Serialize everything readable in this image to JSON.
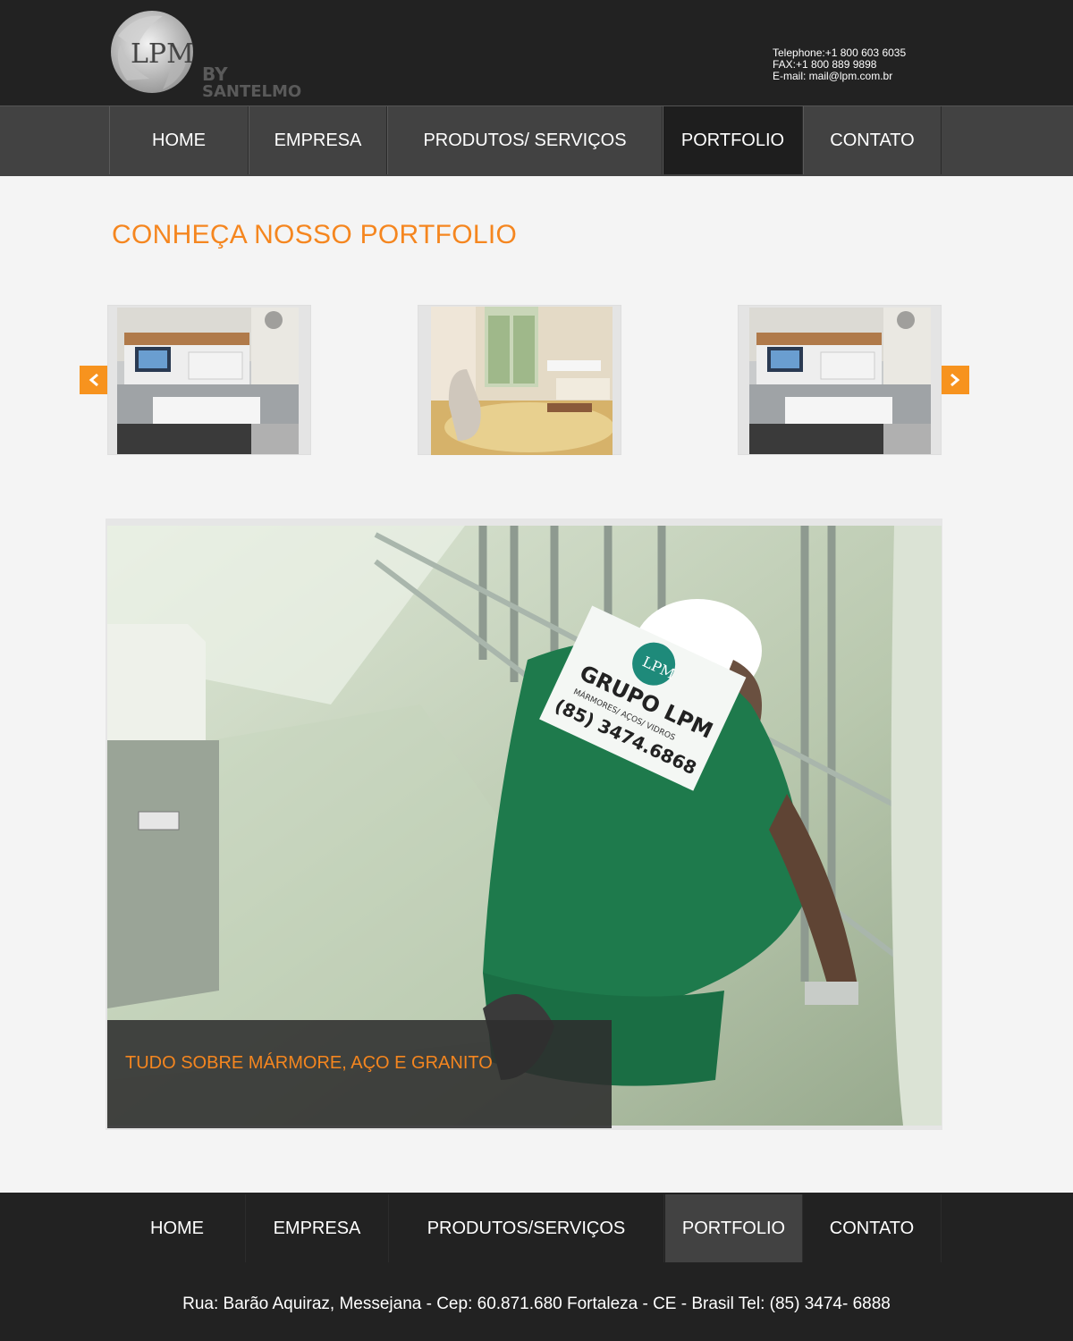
{
  "header": {
    "logo_text": "LPM",
    "logo_by": "BY",
    "logo_brand": "SANTELMO",
    "telephone": "Telephone:+1 800 603 6035",
    "fax": "FAX:+1 800 889 9898",
    "email": "E-mail: mail@lpm.com.br"
  },
  "nav": {
    "items": [
      {
        "label": "HOME"
      },
      {
        "label": "EMPRESA"
      },
      {
        "label": "PRODUTOS/ SERVIÇOS"
      },
      {
        "label": "PORTFOLIO"
      },
      {
        "label": "CONTATO"
      }
    ],
    "active": "PORTFOLIO"
  },
  "portfolio": {
    "title": "CONHEÇA NOSSO PORTFOLIO",
    "thumbnails": [
      "living-room-tv-photo",
      "living-room-chair-photo",
      "living-room-tv-photo"
    ],
    "prev_icon": "chevron-left-icon",
    "next_icon": "chevron-right-icon"
  },
  "hero": {
    "shirt_brand": "GRUPO LPM",
    "shirt_subtitle": "MÁRMORES/ AÇOS/ VIDROS",
    "shirt_phone": "(85) 3474.6868",
    "caption": "TUDO SOBRE MÁRMORE, AÇO E GRANITO"
  },
  "footer": {
    "nav": [
      {
        "label": "HOME"
      },
      {
        "label": "EMPRESA"
      },
      {
        "label": "PRODUTOS/SERVIÇOS"
      },
      {
        "label": "PORTFOLIO"
      },
      {
        "label": "CONTATO"
      }
    ],
    "address": "Rua: Barão Aquiraz, Messejana - Cep: 60.871.680 Fortaleza - CE - Brasil Tel: (85) 3474- 6888"
  },
  "colors": {
    "accent": "#f5861f",
    "header_bg": "#222222",
    "nav_bg": "#424242"
  }
}
